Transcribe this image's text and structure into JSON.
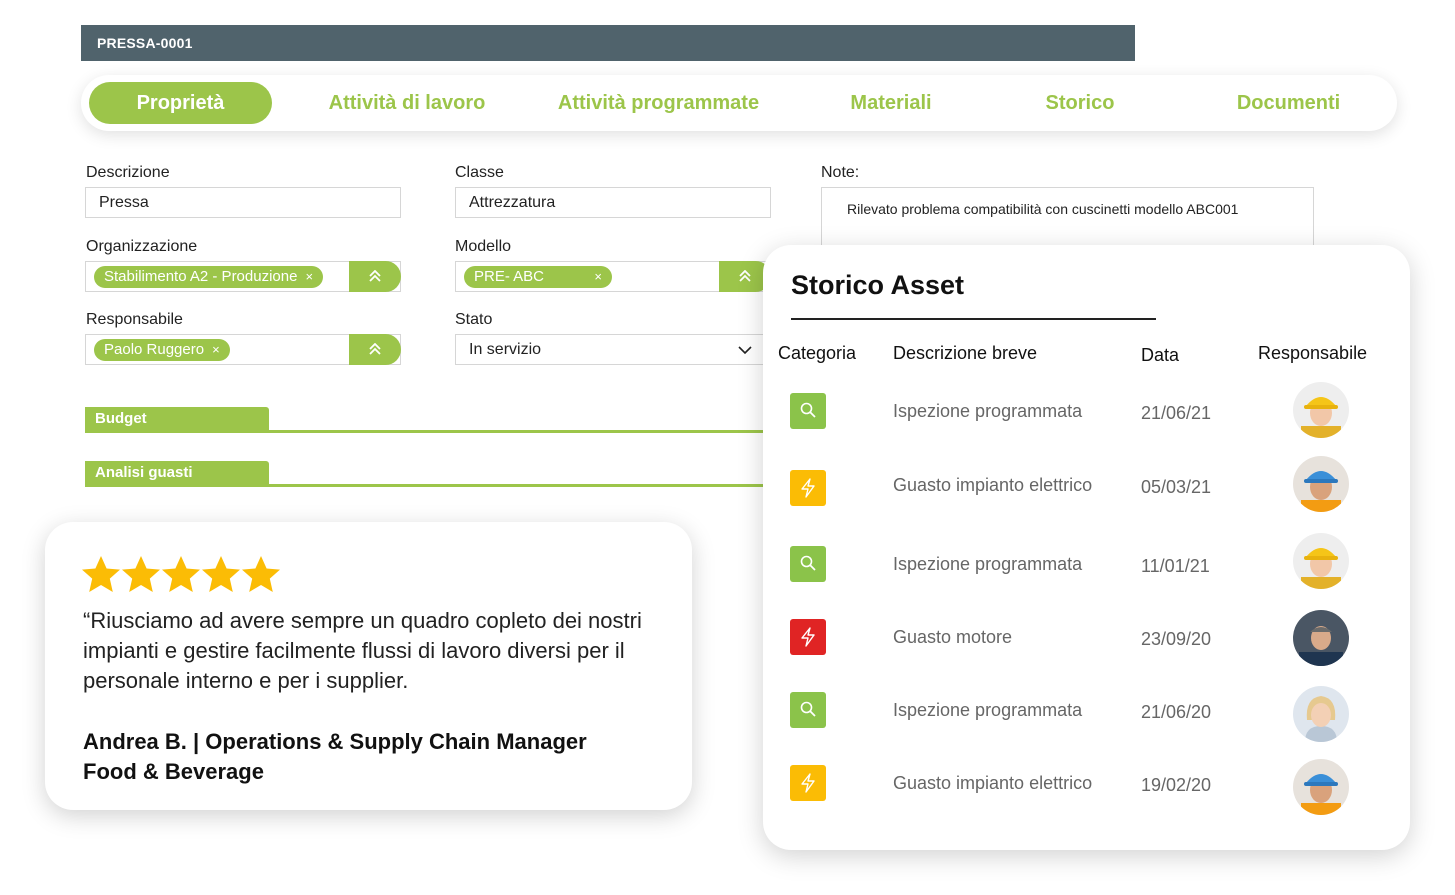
{
  "header": {
    "title": "PRESSA-0001"
  },
  "tabs": [
    {
      "label": "Proprietà",
      "active": true
    },
    {
      "label": "Attività di lavoro",
      "active": false
    },
    {
      "label": "Attività programmate",
      "active": false
    },
    {
      "label": "Materiali",
      "active": false
    },
    {
      "label": "Storico",
      "active": false
    },
    {
      "label": "Documenti",
      "active": false
    }
  ],
  "form": {
    "descrizione": {
      "label": "Descrizione",
      "value": "Pressa"
    },
    "classe": {
      "label": "Classe",
      "value": "Attrezzatura"
    },
    "note": {
      "label": "Note:",
      "value": "Rilevato problema compatibilità con cuscinetti modello ABC001"
    },
    "organizzazione": {
      "label": "Organizzazione",
      "chip": "Stabilimento A2 - Produzione",
      "chip_remove": "×"
    },
    "modello": {
      "label": "Modello",
      "chip": "PRE- ABC",
      "chip_remove": "×"
    },
    "responsabile": {
      "label": "Responsabile",
      "chip": "Paolo Ruggero",
      "chip_remove": "×"
    },
    "stato": {
      "label": "Stato",
      "value": "In servizio",
      "icon": "chevron-down-icon"
    }
  },
  "sections": [
    {
      "label": "Budget"
    },
    {
      "label": "Analisi guasti"
    }
  ],
  "review": {
    "rating": 5,
    "quote": "“Riusciamo ad avere sempre un quadro copleto dei nostri impianti e gestire facilmente flussi di lavoro diversi per il personale interno e per i supplier.",
    "author_line1": "Andrea B. | Operations & Supply Chain Manager",
    "author_line2": "Food & Beverage"
  },
  "storico": {
    "title": "Storico Asset",
    "columns": [
      "Categoria",
      "Descrizione breve",
      "Data",
      "Responsabile"
    ],
    "rows": [
      {
        "category_icon": "search-icon",
        "category_color": "#8bc34a",
        "description": "Ispezione programmata",
        "date": "21/06/21",
        "avatar": "worker-yellow-helmet"
      },
      {
        "category_icon": "lightning-icon",
        "category_color": "#fbbc05",
        "description": "Guasto impianto elettrico",
        "date": "05/03/21",
        "avatar": "worker-blue-helmet"
      },
      {
        "category_icon": "search-icon",
        "category_color": "#8bc34a",
        "description": "Ispezione programmata",
        "date": "11/01/21",
        "avatar": "worker-yellow-helmet"
      },
      {
        "category_icon": "lightning-icon",
        "category_color": "#e02424",
        "description": "Guasto motore",
        "date": "23/09/20",
        "avatar": "worker-mechanic"
      },
      {
        "category_icon": "search-icon",
        "category_color": "#8bc34a",
        "description": "Ispezione programmata",
        "date": "21/06/20",
        "avatar": "person-blonde"
      },
      {
        "category_icon": "lightning-icon",
        "category_color": "#fbbc05",
        "description": "Guasto impianto elettrico",
        "date": "19/02/20",
        "avatar": "worker-blue-helmet"
      }
    ]
  },
  "colors": {
    "accent": "#9cc54a",
    "header": "#50636c",
    "star": "#fbbc05"
  }
}
